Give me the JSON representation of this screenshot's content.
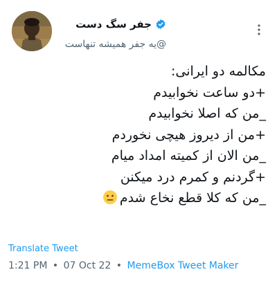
{
  "user": {
    "display_name": "جفر سگ دست",
    "handle": "@یه جفر همیشه تنهاست",
    "verified": true
  },
  "tweet": {
    "lines": [
      "مکالمه دو ایرانی:",
      "+دو ساعت نخوابیدم",
      "_من که اصلا نخوابیدم",
      "+من از دیروز هیچی نخوردم",
      "_من الان از کمیته امداد میام",
      "+گردنم و کمرم درد میکنن",
      "_من که کلا قطع نخاع شدم"
    ],
    "last_line_emoji": "neutral-face-emoji"
  },
  "translate_label": "Translate Tweet",
  "meta": {
    "time": "1:21 PM",
    "separator": "•",
    "date": "07 Oct 22",
    "source": "MemeBox Tweet Maker"
  },
  "colors": {
    "accent": "#1d9bf0",
    "secondary_text": "#536471",
    "primary_text": "#0f1419"
  }
}
